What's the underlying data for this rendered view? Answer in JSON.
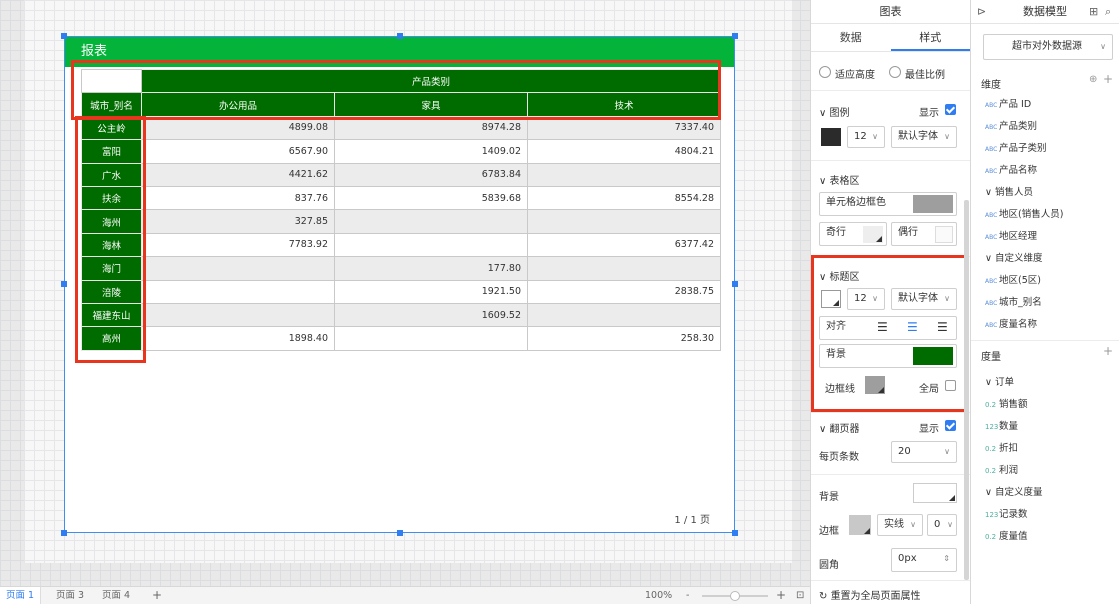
{
  "report": {
    "title": "报表",
    "group_header": "产品类别",
    "row_header": "城市_别名",
    "columns": [
      "办公用品",
      "家具",
      "技术"
    ],
    "rows": [
      {
        "city": "公主岭",
        "values": [
          "4899.08",
          "8974.28",
          "7337.40"
        ]
      },
      {
        "city": "富阳",
        "values": [
          "6567.90",
          "1409.02",
          "4804.21"
        ]
      },
      {
        "city": "广水",
        "values": [
          "4421.62",
          "6783.84",
          ""
        ]
      },
      {
        "city": "扶余",
        "values": [
          "837.76",
          "5839.68",
          "8554.28"
        ]
      },
      {
        "city": "海州",
        "values": [
          "327.85",
          "",
          ""
        ]
      },
      {
        "city": "海林",
        "values": [
          "7783.92",
          "",
          "6377.42"
        ]
      },
      {
        "city": "海门",
        "values": [
          "",
          "177.80",
          ""
        ]
      },
      {
        "city": "涪陵",
        "values": [
          "",
          "1921.50",
          "2838.75"
        ]
      },
      {
        "city": "福建东山",
        "values": [
          "",
          "1609.52",
          ""
        ]
      },
      {
        "city": "高州",
        "values": [
          "1898.40",
          "",
          "258.30"
        ]
      }
    ],
    "pager": "1 / 1 页"
  },
  "bottom_bar": {
    "pages": [
      "页面 1",
      "页面 3",
      "页面 4"
    ],
    "add": "+",
    "zoom": "100%",
    "minus": "-",
    "plus": "+"
  },
  "style_panel": {
    "header": "图表",
    "tabs": [
      "数据",
      "样式"
    ],
    "fit_height": "适应高度",
    "best_ratio": "最佳比例",
    "legend": {
      "title": "图例",
      "show": "显示",
      "size": "12",
      "font": "默认字体"
    },
    "table_area": {
      "title": "表格区",
      "cell_border": "单元格边框色",
      "odd": "奇行",
      "even": "偶行"
    },
    "title_area": {
      "title": "标题区",
      "size": "12",
      "font": "默认字体",
      "align": "对齐",
      "background": "背景",
      "border": "边框线",
      "global": "全局"
    },
    "pager": {
      "title": "翻页器",
      "show": "显示",
      "per_page": "每页条数",
      "per_page_value": "20"
    },
    "background": "背景",
    "border": "边框",
    "border_style": "实线",
    "border_width": "0",
    "radius": "圆角",
    "radius_value": "0px",
    "reset": "重置为全局页面属性"
  },
  "data_model": {
    "header": "数据模型",
    "source": "超市对外数据源",
    "dimensions_title": "维度",
    "dimensions": [
      {
        "type": "ABC",
        "name": "产品 ID",
        "group": false
      },
      {
        "type": "ABC",
        "name": "产品类别",
        "group": false
      },
      {
        "type": "ABC",
        "name": "产品子类别",
        "group": false
      },
      {
        "type": "ABC",
        "name": "产品名称",
        "group": false
      },
      {
        "type": "",
        "name": "销售人员",
        "group": true
      },
      {
        "type": "ABC",
        "name": "地区(销售人员)",
        "group": false
      },
      {
        "type": "ABC",
        "name": "地区经理",
        "group": false
      },
      {
        "type": "",
        "name": "自定义维度",
        "group": true
      },
      {
        "type": "ABC",
        "name": "地区(5区)",
        "group": false
      },
      {
        "type": "ABC",
        "name": "城市_别名",
        "group": false
      },
      {
        "type": "ABC",
        "name": "度量名称",
        "group": false
      }
    ],
    "measures_title": "度量",
    "measures": [
      {
        "type": "",
        "name": "订单",
        "group": true
      },
      {
        "type": "0.2",
        "name": "销售额",
        "group": false
      },
      {
        "type": "123",
        "name": "数量",
        "group": false
      },
      {
        "type": "0.2",
        "name": "折扣",
        "group": false
      },
      {
        "type": "0.2",
        "name": "利润",
        "group": false
      },
      {
        "type": "",
        "name": "自定义度量",
        "group": true
      },
      {
        "type": "123",
        "name": "记录数",
        "group": false
      },
      {
        "type": "0.2",
        "name": "度量值",
        "group": false
      }
    ]
  },
  "colors": {
    "title_bar": "#04b43a",
    "header_bg": "#006c00",
    "highlight": "#e8351d",
    "accent": "#2f7df0"
  }
}
